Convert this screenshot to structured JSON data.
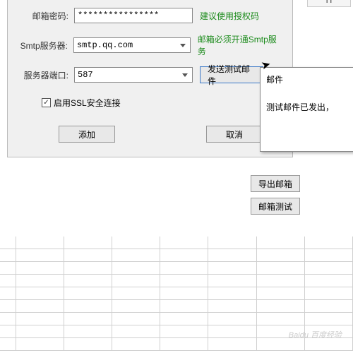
{
  "columnHeader": "H",
  "form": {
    "passwordLabel": "邮箱密码:",
    "passwordValue": "****************",
    "passwordHint": "建议使用授权码",
    "smtpLabel": "Smtp服务器:",
    "smtpValue": "smtp.qq.com",
    "smtpHint": "邮箱必须开通Smtp服务",
    "portLabel": "服务器端口:",
    "portValue": "587",
    "testSendBtn": "发送测试邮件",
    "sslCheckbox": "启用SSL安全连接",
    "sslChecked": "✓",
    "addBtn": "添加",
    "cancelBtn": "取消"
  },
  "panel": {
    "exportBtn": "导出邮箱",
    "testBtn": "邮箱测试"
  },
  "popup": {
    "title": "邮件",
    "message": "测试邮件已发出，"
  },
  "gridCols": [
    24,
    72,
    72,
    72,
    72,
    72,
    72,
    72
  ],
  "watermark": "Baidu 百度经验"
}
